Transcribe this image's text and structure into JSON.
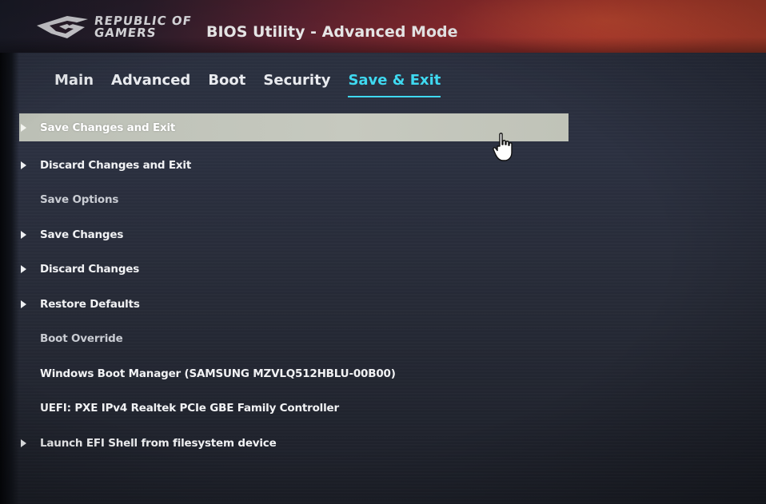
{
  "header": {
    "brand_line1": "REPUBLIC OF",
    "brand_line2": "GAMERS",
    "title": "BIOS Utility - Advanced Mode",
    "logo_icon": "rog-eye-icon"
  },
  "tabs": [
    {
      "label": "Main",
      "active": false
    },
    {
      "label": "Advanced",
      "active": false
    },
    {
      "label": "Boot",
      "active": false
    },
    {
      "label": "Security",
      "active": false
    },
    {
      "label": "Save & Exit",
      "active": true
    }
  ],
  "menu": {
    "items": [
      {
        "label": "Save Changes and Exit",
        "has_arrow": true,
        "selected": true
      },
      {
        "label": "Discard Changes and Exit",
        "has_arrow": true
      },
      {
        "label": "Save Options",
        "section_header": true
      },
      {
        "label": "Save Changes",
        "has_arrow": true
      },
      {
        "label": "Discard Changes",
        "has_arrow": true
      },
      {
        "label": "Restore Defaults",
        "has_arrow": true
      },
      {
        "label": "Boot Override",
        "section_header": true
      },
      {
        "label": "Windows Boot Manager (SAMSUNG MZVLQ512HBLU-00B00)"
      },
      {
        "label": "UEFI: PXE IPv4 Realtek PCIe GBE Family Controller"
      },
      {
        "label": "Launch EFI Shell from filesystem device",
        "has_arrow": true
      }
    ]
  },
  "pointer": {
    "icon": "hand-pointer-icon"
  },
  "colors": {
    "accent": "#3fd9f0",
    "header_red": "#b93a30",
    "selection_bar": "#c6c9bf",
    "background": "#2b3040"
  }
}
